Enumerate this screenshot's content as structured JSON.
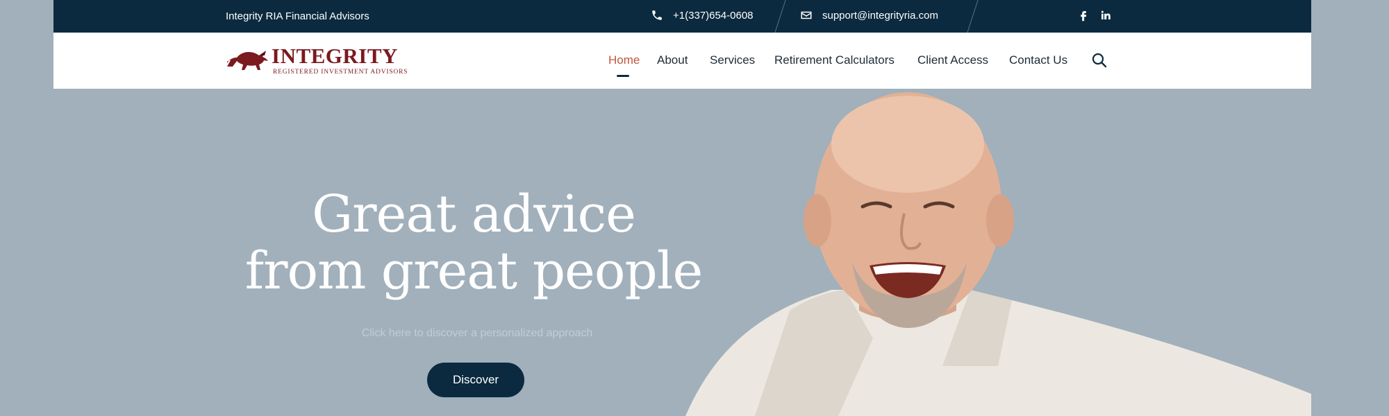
{
  "topbar": {
    "company": "Integrity RIA Financial Advisors",
    "phone": "+1(337)654-0608",
    "email": "support@integrityria.com",
    "social": [
      "facebook-icon",
      "linkedin-icon"
    ]
  },
  "header": {
    "logo": {
      "name": "INTEGRITY",
      "tagline": "REGISTERED INVESTMENT ADVISORS"
    },
    "nav": [
      {
        "label": "Home",
        "active": true
      },
      {
        "label": "About"
      },
      {
        "label": "Services"
      },
      {
        "label": "Retirement Calculators"
      },
      {
        "label": "Client Access"
      },
      {
        "label": "Contact Us"
      }
    ],
    "search_icon": "search-icon"
  },
  "hero": {
    "title_line1": "Great advice",
    "title_line2": "from great people",
    "subtitle": "Click here to discover a personalized approach",
    "button": "Discover"
  },
  "colors": {
    "navy": "#0b2a3f",
    "brand_red": "#7b1a1f",
    "active_nav": "#c0563d",
    "hero_bg": "#a1b0bb"
  }
}
